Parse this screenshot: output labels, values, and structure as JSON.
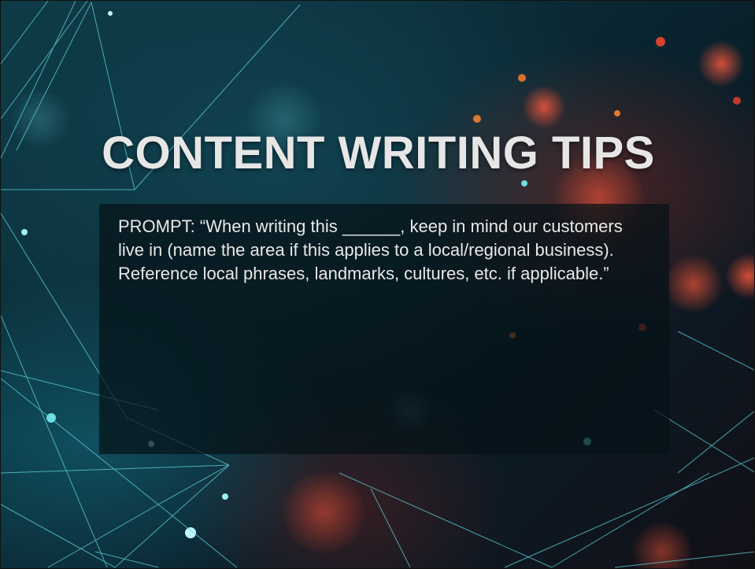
{
  "slide": {
    "title": "CONTENT WRITING TIPS",
    "body": "PROMPT: “When writing this ______, keep in mind our customers live in (name the area if this applies to a local/regional business). Reference local phrases, landmarks, cultures, etc. if applicable.”"
  },
  "colors": {
    "title_text": "#e6e6e6",
    "body_text": "#e8e8e8",
    "background_teal": "#0d3a44",
    "accent_red": "#c0392b",
    "line_cyan": "#5fd4dc"
  }
}
